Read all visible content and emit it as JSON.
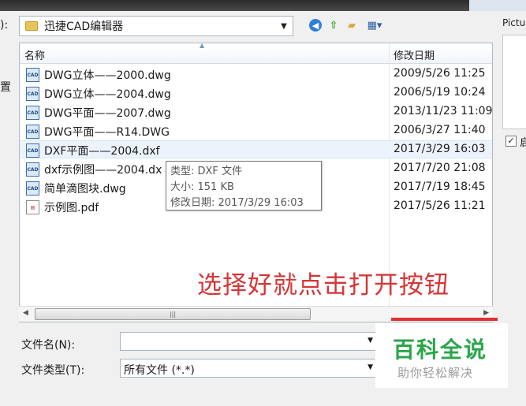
{
  "window": {
    "left_fragment": "):",
    "left_fragment2": "置"
  },
  "toolbar": {
    "look_in_value": "迅捷CAD编辑器",
    "back_icon": "back-arrow-icon",
    "up_icon": "up-folder-icon",
    "new_folder_icon": "new-folder-icon",
    "view_icon": "view-menu-icon"
  },
  "preview": {
    "label": "Pictur",
    "checkbox_label": "启",
    "checked": true
  },
  "file_list": {
    "columns": {
      "name": "名称",
      "date": "修改日期"
    },
    "rows": [
      {
        "name": "DWG立体——2000.dwg",
        "date": "2009/5/26 11:25",
        "icon": "cad-file-icon"
      },
      {
        "name": "DWG立体——2004.dwg",
        "date": "2006/5/19 10:24",
        "icon": "cad-file-icon"
      },
      {
        "name": "DWG平面——2007.dwg",
        "date": "2013/11/23 11:09",
        "icon": "cad-file-icon"
      },
      {
        "name": "DWG平面——R14.DWG",
        "date": "2006/3/27 11:40",
        "icon": "cad-file-icon"
      },
      {
        "name": "DXF平面——2004.dxf",
        "date": "2017/3/29 16:03",
        "icon": "cad-file-icon"
      },
      {
        "name": "dxf示例图——2004.dx",
        "date": "2017/7/20 21:08",
        "icon": "cad-file-icon"
      },
      {
        "name": "简单滴图块.dwg",
        "date": "2017/7/19 18:45",
        "icon": "cad-file-icon"
      },
      {
        "name": "示例图.pdf",
        "date": "2017/5/26 11:21",
        "icon": "pdf-file-icon"
      }
    ],
    "icon_text": "CAD"
  },
  "tooltip": {
    "type": "类型: DXF 文件",
    "size": "大小: 151 KB",
    "modified": "修改日期: 2017/3/29 16:03"
  },
  "annotation": "选择好就点击打开按钮",
  "form": {
    "filename_label": "文件名(N):",
    "filename_value": "",
    "filetype_label": "文件类型(T):",
    "filetype_value": "所有文件 (*.*)"
  },
  "watermark": {
    "title": "百科全说",
    "subtitle": "助你轻松解决"
  },
  "colors": {
    "annotation": "#d63535",
    "watermark": "#2aa64a",
    "selection": "#edf3fb"
  }
}
